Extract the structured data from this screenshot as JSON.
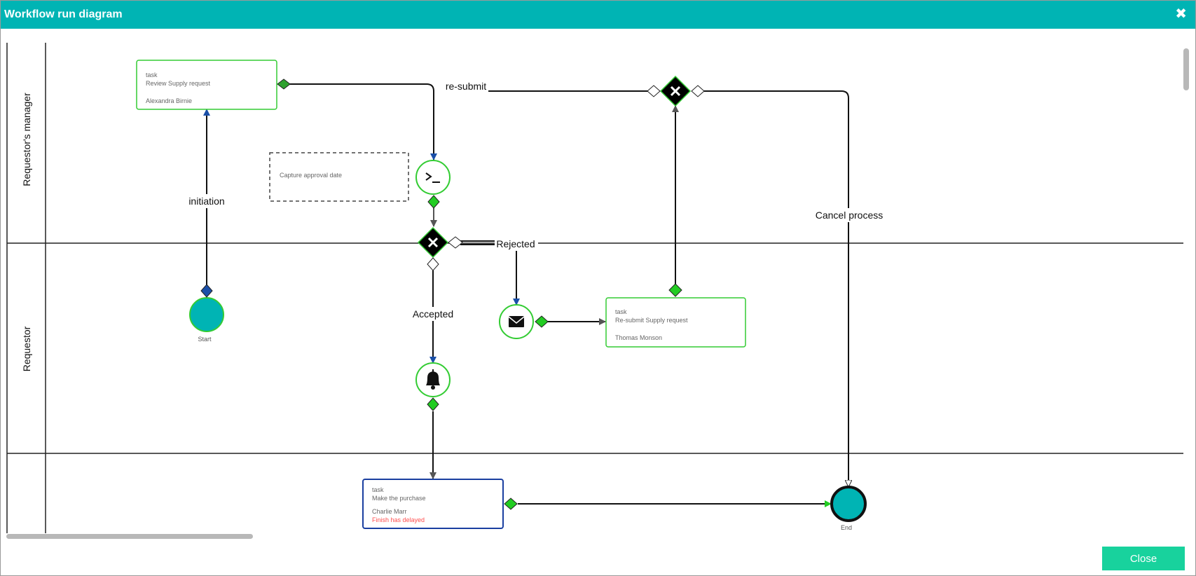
{
  "dialog": {
    "title": "Workflow run diagram",
    "close_icon": "close-icon",
    "close_button_label": "Close"
  },
  "lanes": {
    "manager": "Requestor's manager",
    "requestor": "Requestor",
    "third": ""
  },
  "tasks": {
    "review": {
      "type": "task",
      "name": "Review Supply request",
      "assignee": "Alexandra Birnie"
    },
    "resubmit": {
      "type": "task",
      "name": "Re-submit Supply request",
      "assignee": "Thomas Monson"
    },
    "purchase": {
      "type": "task",
      "name": "Make the purchase",
      "assignee": "Charlie Marr",
      "status": "Finish has delayed"
    }
  },
  "annotation": "Capture approval date",
  "events": {
    "start": "Start",
    "end": "End"
  },
  "flow_labels": {
    "initiation": "initiation",
    "resubmit": "re-submit",
    "cancel": "Cancel process",
    "rejected": "Rejected",
    "accepted": "Accepted"
  },
  "icons": {
    "script": "terminal-icon",
    "message": "envelope-icon",
    "notification": "bell-icon",
    "gateway": "exclusive-gateway-x-icon"
  },
  "colors": {
    "titlebar": "#00b4b4",
    "completed": "#22cc22",
    "active_border": "#1a3fa0",
    "event_fill": "#00b4b4",
    "button": "#18d29d",
    "delay_text": "#ff4d4d"
  }
}
